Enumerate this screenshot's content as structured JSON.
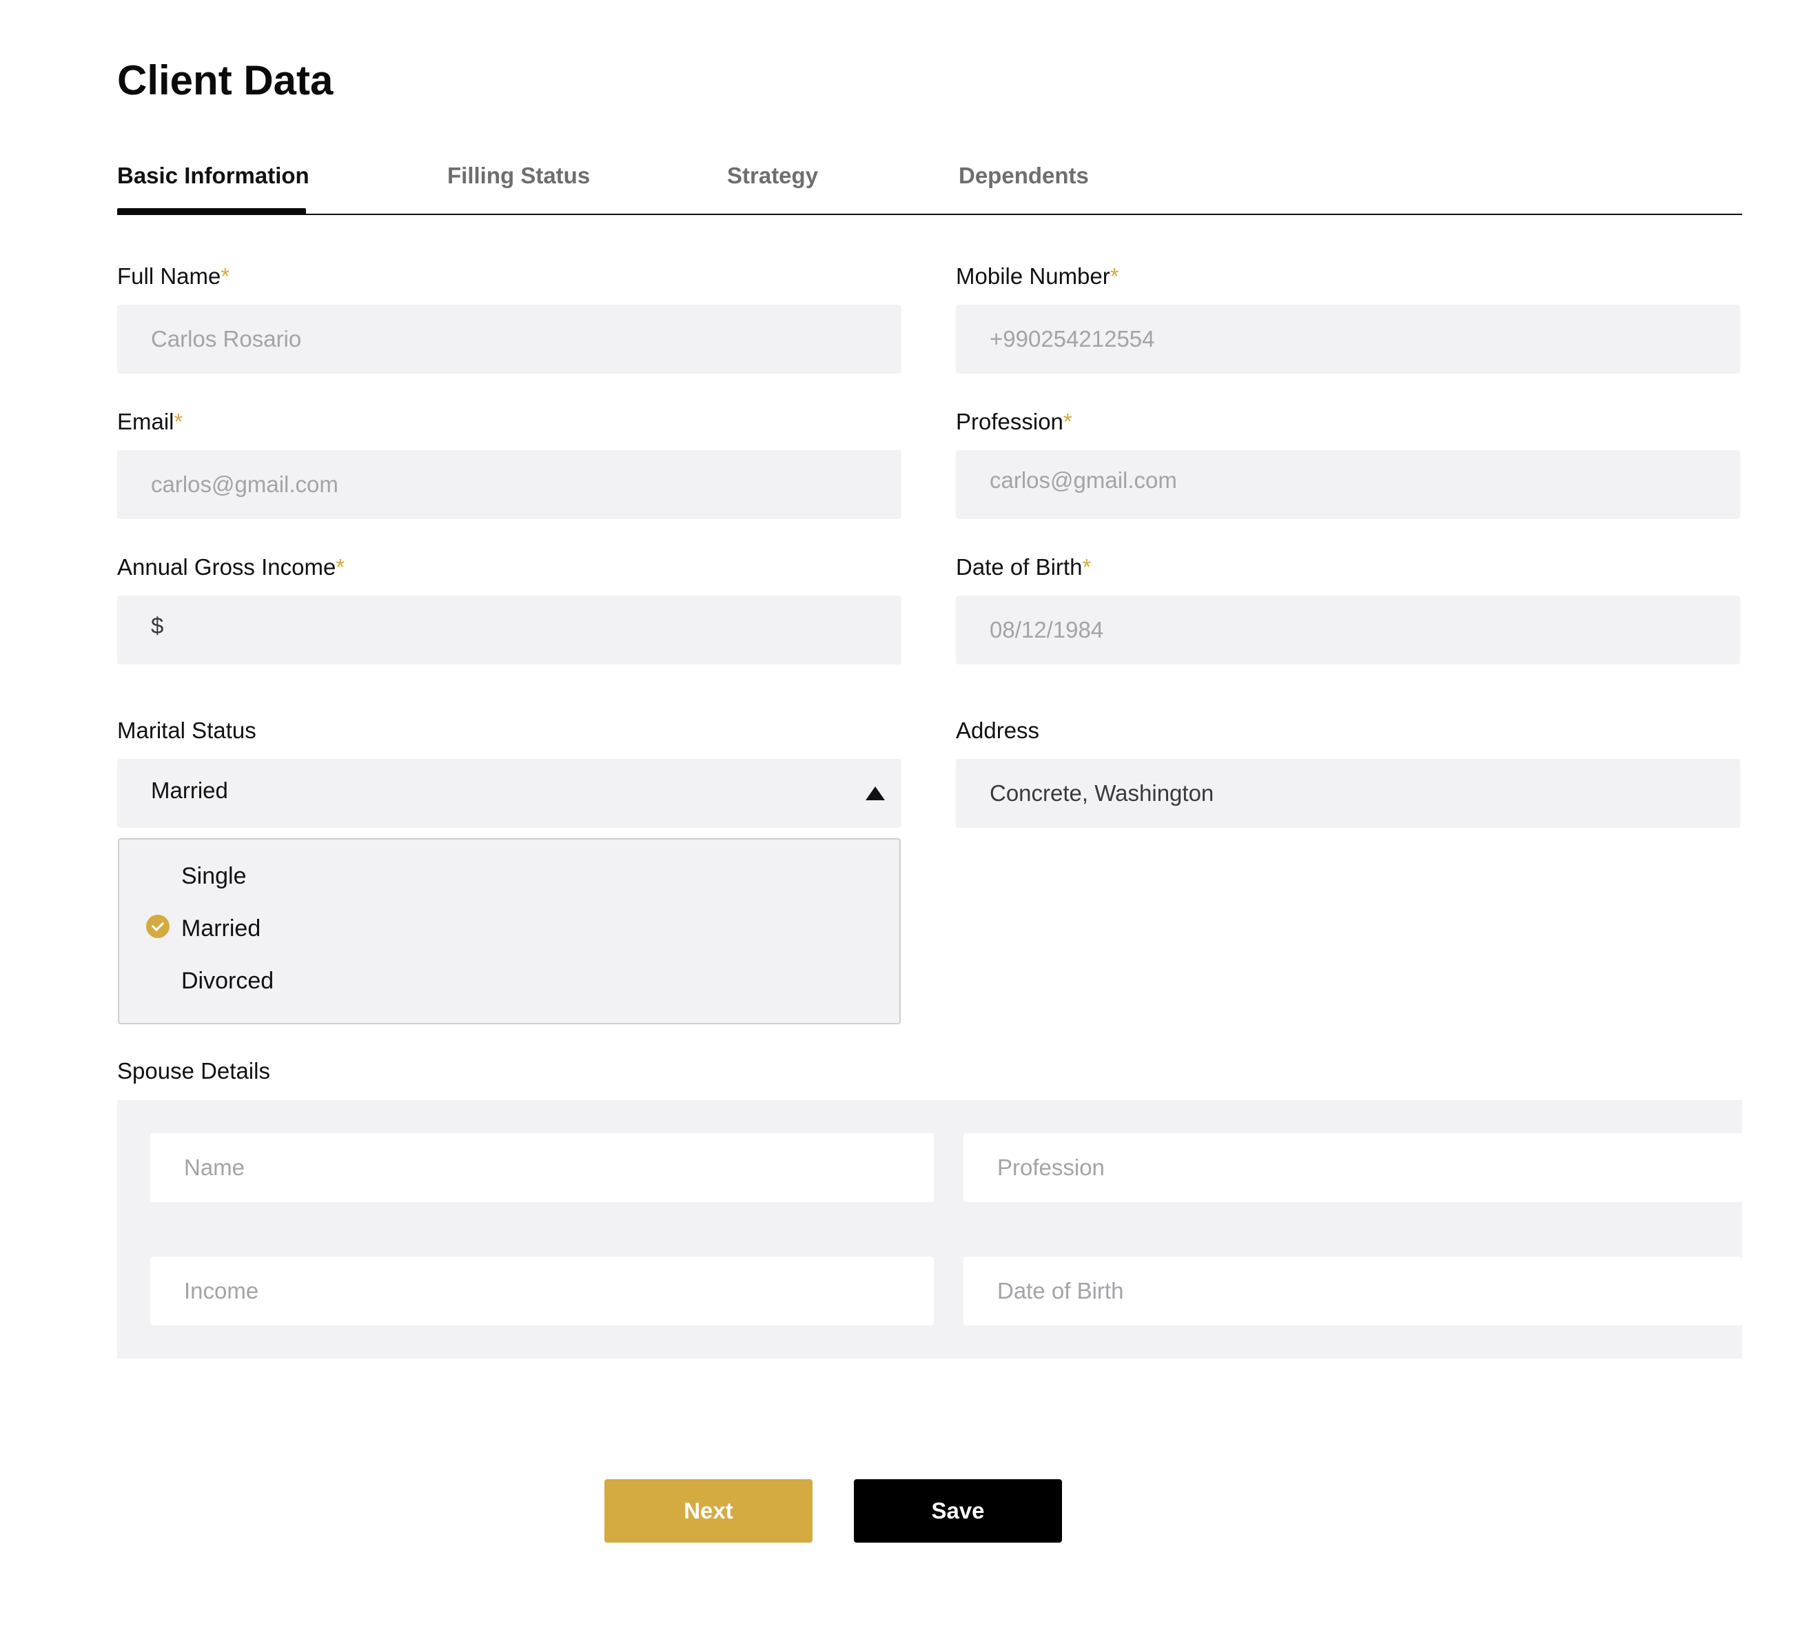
{
  "page_title": "Client Data",
  "tabs": [
    {
      "label": "Basic Information",
      "active": true
    },
    {
      "label": "Filling Status",
      "active": false
    },
    {
      "label": "Strategy",
      "active": false
    },
    {
      "label": "Dependents",
      "active": false
    }
  ],
  "required_marker": "*",
  "fields": {
    "full_name": {
      "label": "Full Name",
      "placeholder": "Carlos Rosario"
    },
    "mobile_number": {
      "label": "Mobile Number",
      "placeholder": "+990254212554"
    },
    "email": {
      "label": "Email",
      "placeholder": "carlos@gmail.com"
    },
    "profession": {
      "label": "Profession",
      "placeholder": "carlos@gmail.com"
    },
    "annual_gross_income": {
      "label": "Annual Gross Income",
      "prefix": "$"
    },
    "date_of_birth": {
      "label": "Date of Birth",
      "placeholder": "08/12/1984"
    },
    "marital_status": {
      "label": "Marital Status",
      "value": "Married",
      "options": [
        "Single",
        "Married",
        "Divorced"
      ],
      "selected": "Married"
    },
    "address": {
      "label": "Address",
      "value": "Concrete, Washington"
    }
  },
  "spouse": {
    "title": "Spouse Details",
    "name_placeholder": "Name",
    "profession_placeholder": "Profession",
    "income_placeholder": "Income",
    "dob_placeholder": "Date of Birth"
  },
  "buttons": {
    "next": "Next",
    "save": "Save"
  },
  "colors": {
    "accent": "#d4ab41",
    "field_bg": "#f2f2f4",
    "dark": "#000000"
  }
}
